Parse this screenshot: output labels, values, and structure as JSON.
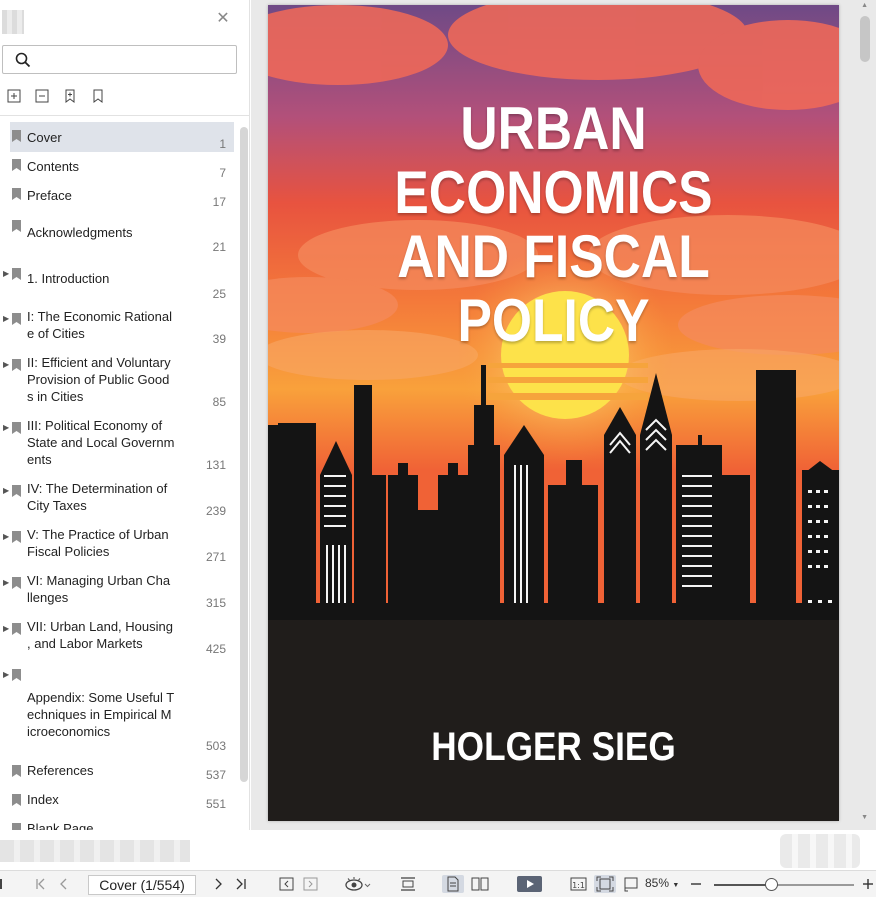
{
  "sidebar": {
    "search_placeholder": "",
    "toc": [
      {
        "label": "Cover",
        "page": "1",
        "active": true,
        "expandable": false
      },
      {
        "label": "Contents",
        "page": "7",
        "active": false,
        "expandable": false
      },
      {
        "label": "Preface",
        "page": "17",
        "active": false,
        "expandable": false
      },
      {
        "label": "Acknowledgments",
        "page": "21",
        "active": false,
        "expandable": false
      },
      {
        "label": "1. Introduction",
        "page": "25",
        "active": false,
        "expandable": true
      },
      {
        "label": "I: The Economic Rational\ne of Cities",
        "page": "39",
        "active": false,
        "expandable": true
      },
      {
        "label": "II: Efficient and Voluntary\nProvision of Public Good\ns in Cities",
        "page": "85",
        "active": false,
        "expandable": true
      },
      {
        "label": "III: Political Economy of\nState and Local Governm\nents",
        "page": "131",
        "active": false,
        "expandable": true
      },
      {
        "label": "IV: The Determination of\nCity Taxes",
        "page": "239",
        "active": false,
        "expandable": true
      },
      {
        "label": "V: The Practice of Urban\nFiscal Policies",
        "page": "271",
        "active": false,
        "expandable": true
      },
      {
        "label": "VI: Managing Urban Cha\nllenges",
        "page": "315",
        "active": false,
        "expandable": true
      },
      {
        "label": "VII: Urban Land, Housing\n, and Labor Markets",
        "page": "425",
        "active": false,
        "expandable": true
      },
      {
        "label": "Appendix: Some Useful T\nechniques in Empirical M\nicroeconomics",
        "page": "503",
        "active": false,
        "expandable": true
      },
      {
        "label": "References",
        "page": "537",
        "active": false,
        "expandable": false
      },
      {
        "label": "Index",
        "page": "551",
        "active": false,
        "expandable": false
      },
      {
        "label": "Blank Page",
        "page": "",
        "active": false,
        "expandable": false
      }
    ]
  },
  "cover": {
    "title_line1": "URBAN ECONOMICS",
    "title_line2": "AND FISCAL POLICY",
    "author": "HOLGER SIEG"
  },
  "statusbar": {
    "page_indicator": "Cover (1/554)",
    "zoom": "85%",
    "zoom_level": 0.41,
    "actual_size_label": "1:1"
  },
  "colors": {
    "accent": "#dfe3ea",
    "sky_top": "#7a4d86",
    "sky_mid": "#ea5a3f",
    "sky_low": "#f7a13c",
    "sun": "#fde24a",
    "ground": "#1f1c1a"
  }
}
